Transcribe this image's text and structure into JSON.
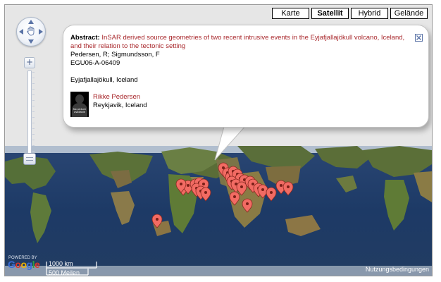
{
  "map_types": [
    {
      "label": "Karte",
      "active": false
    },
    {
      "label": "Satellit",
      "active": true
    },
    {
      "label": "Hybrid",
      "active": false
    },
    {
      "label": "Gelände",
      "active": false
    }
  ],
  "zoom": {
    "plus": "+",
    "minus": "−",
    "level_fraction": 0.0
  },
  "info_window": {
    "abstract_label": "Abstract:",
    "abstract_title": "InSAR derived source geometries of two recent intrusive events in the Eyjafjallajökull volcano, Iceland, and their relation to the tectonic setting",
    "authors": "Pedersen, R; Sigmundsson, F",
    "id": "EGU06-A-06409",
    "location": "Eyjafjallajökull, Iceland",
    "avatar_caption": "No picture available",
    "person_name": "Rikke Pedersen",
    "person_location": "Reykjavik, Iceland"
  },
  "footer": {
    "logo": "Google",
    "powered_by": "POWERED BY",
    "scale_km": "1000 km",
    "scale_mi": "500 Meilen",
    "terms": "Nutzungsbedingungen"
  },
  "colors": {
    "ocean": "#1f3b62",
    "land": "#4f6b32",
    "marker": "#f26b63",
    "link_red": "#a8272b"
  }
}
